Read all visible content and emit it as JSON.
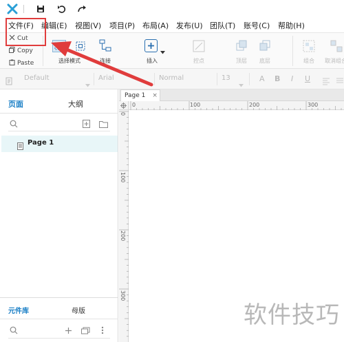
{
  "window": {
    "logo_icon": "axure-x-logo-icon",
    "save_icon": "save-icon",
    "undo_icon": "undo-icon",
    "redo_icon": "redo-icon"
  },
  "menu": {
    "items": [
      "文件(F)",
      "编辑(E)",
      "视图(V)",
      "项目(P)",
      "布局(A)",
      "发布(U)",
      "团队(T)",
      "账号(C)",
      "帮助(H)"
    ]
  },
  "clipboard": {
    "cut": "Cut",
    "copy": "Copy",
    "paste": "Paste"
  },
  "toolbar": {
    "select_mode_label": "选择模式",
    "connect_label": "连接",
    "insert_label": "插入",
    "points_label": "控点",
    "top_label": "顶层",
    "bottom_label": "底层",
    "group_label": "组合",
    "ungroup_label": "取消组合"
  },
  "format": {
    "style": "Default",
    "font": "Arial",
    "weight": "Normal",
    "size": "13",
    "font_color": "A",
    "bold": "B",
    "italic": "I",
    "underline": "U"
  },
  "left_panel": {
    "tab_pages": "页面",
    "tab_outline": "大纲",
    "page_item": "Page 1",
    "tab_library": "元件库",
    "tab_masters": "母版"
  },
  "canvas": {
    "tab_title": "Page 1",
    "tab_close": "×",
    "h_ruler": [
      "0",
      "100",
      "200",
      "300"
    ],
    "v_ruler": [
      "0",
      "100",
      "200",
      "300"
    ]
  },
  "watermark": "软件技巧",
  "colors": {
    "accent": "#1a7fc6",
    "highlight_red": "#e03c3c",
    "selected_row": "#e8f6f8"
  }
}
